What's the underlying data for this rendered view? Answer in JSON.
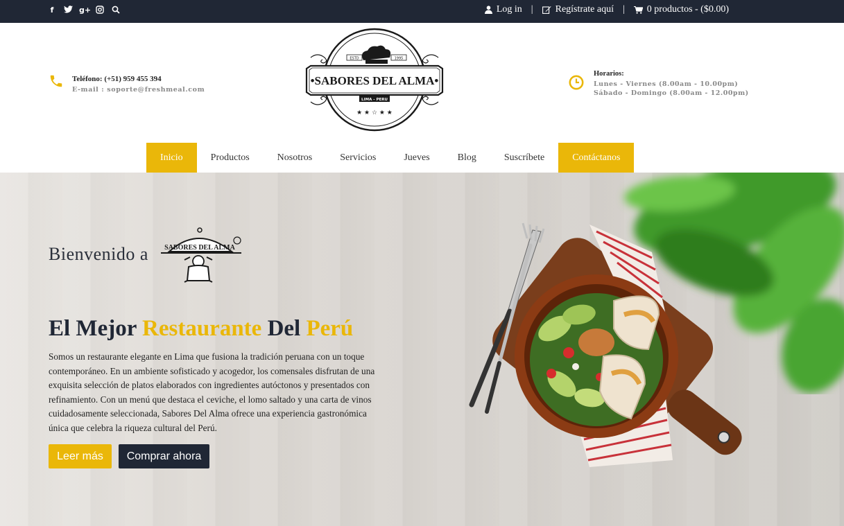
{
  "topbar": {
    "social": [
      {
        "icon": "facebook-icon",
        "glyph": "f"
      },
      {
        "icon": "twitter-icon",
        "glyph": "t"
      },
      {
        "icon": "google-plus-icon",
        "glyph": "g+"
      },
      {
        "icon": "instagram-icon",
        "glyph": "◘"
      },
      {
        "icon": "search-icon",
        "glyph": "⚲"
      }
    ],
    "login_label": "Log in",
    "register_label": "Regístrate aquí",
    "cart_label": "0 productos - ($0.00)",
    "separator": "|"
  },
  "header": {
    "phone_label": "Teléfono: (+51) 959 455 394",
    "email_label": "E-mail : soporte@freshmeal.com",
    "hours_title": "Horarios:",
    "hours_weekday": "Lunes - Viernes (8.00am - 10.00pm)",
    "hours_weekend": "Sábado - Domingo (8.00am - 12.00pm)",
    "logo": {
      "name": "•SABORES DEL ALMA•",
      "estd": "ESTD",
      "year": "1995",
      "location": "LIMA - PERU",
      "stars": "★ ★ ☆ ★ ★"
    }
  },
  "nav": {
    "items": [
      "Inicio",
      "Productos",
      "Nosotros",
      "Servicios",
      "Jueves",
      "Blog",
      "Suscríbete"
    ],
    "cta": "Contáctanos",
    "active": "Inicio"
  },
  "hero": {
    "welcome": "Bienvenido a",
    "minilogo_text": "SABORES DEL ALMA",
    "headline_1": "El Mejor ",
    "headline_2": "Restaurante",
    "headline_3": " Del ",
    "headline_4": "Perú",
    "description": "Somos un restaurante elegante en Lima que fusiona la tradición peruana con un toque contemporáneo. En un ambiente sofisticado y acogedor, los comensales disfrutan de una exquisita selección de platos elaborados con ingredientes autóctonos y presentados con refinamiento. Con un menú que destaca el ceviche, el lomo saltado y una carta de vinos cuidadosamente seleccionada, Sabores Del Alma ofrece una experiencia gastronómica única que celebra la riqueza cultural del Perú.",
    "btn_more": "Leer más",
    "btn_buy": "Comprar ahora"
  },
  "colors": {
    "accent": "#eab709",
    "dark": "#202735"
  }
}
